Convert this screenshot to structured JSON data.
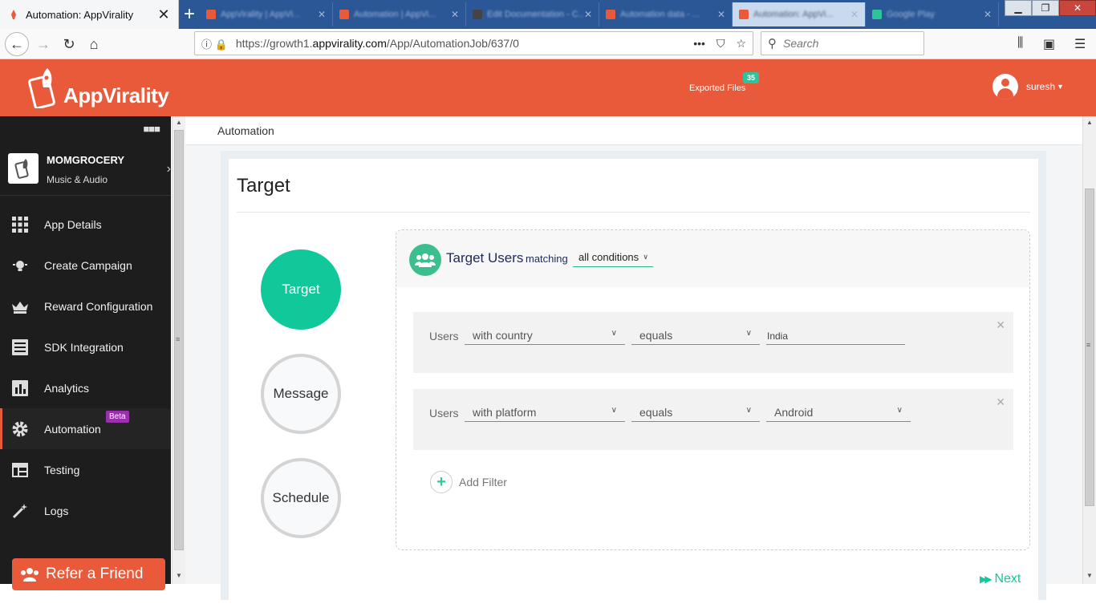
{
  "browser": {
    "active_tab_title": "Automation: AppVirality",
    "background_tabs": [
      "AppVirality | AppVi...",
      "Automation | AppVi...",
      "Edit Documentation - C...",
      "Automation data - ...",
      "Automation: AppVi...",
      "Google Play"
    ],
    "url_prefix": "https://growth1.",
    "url_domain": "appvirality.com",
    "url_path": "/App/AutomationJob/637/0",
    "search_placeholder": "Search"
  },
  "header": {
    "brand": "AppVirality",
    "exported_label": "Exported Files",
    "exported_count": "35",
    "username": "suresh"
  },
  "sidebar": {
    "app_name": "MOMGROCERY",
    "app_category": "Music & Audio",
    "items": [
      {
        "label": "App Details",
        "icon": "grid-icon"
      },
      {
        "label": "Create Campaign",
        "icon": "bulb-icon"
      },
      {
        "label": "Reward Configuration",
        "icon": "crown-icon"
      },
      {
        "label": "SDK Integration",
        "icon": "list-icon"
      },
      {
        "label": "Analytics",
        "icon": "bar-chart-icon"
      },
      {
        "label": "Automation",
        "icon": "gear-icon",
        "badge": "Beta"
      },
      {
        "label": "Testing",
        "icon": "layout-icon"
      },
      {
        "label": "Logs",
        "icon": "wand-icon"
      }
    ],
    "refer_label": "Refer a Friend"
  },
  "main": {
    "breadcrumb": "Automation",
    "card_title": "Target",
    "steps": [
      "Target",
      "Message",
      "Schedule"
    ],
    "panel": {
      "title": "Target Users",
      "matching_label": "matching",
      "condition_value": "all conditions"
    },
    "filters": [
      {
        "subject": "Users",
        "field": "with country",
        "operator": "equals",
        "value": "India"
      },
      {
        "subject": "Users",
        "field": "with platform",
        "operator": "equals",
        "value": "Android"
      }
    ],
    "add_filter_label": "Add Filter",
    "next_label": "Next"
  },
  "colors": {
    "brand_orange": "#e85a3a",
    "accent_green": "#10c89a",
    "sidebar_bg": "#1d1d1d",
    "beta_purple": "#9b2fae"
  }
}
